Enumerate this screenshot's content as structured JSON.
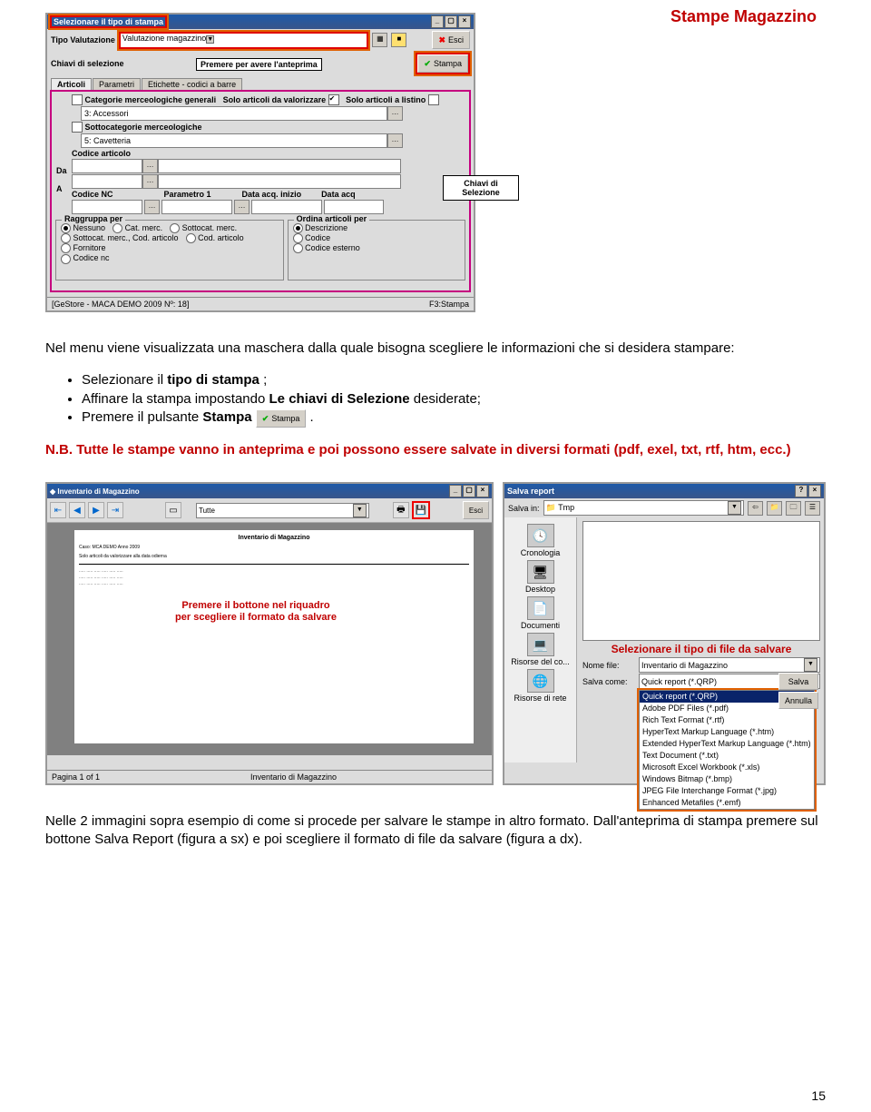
{
  "header": "Stampe Magazzino",
  "dlg1": {
    "title": "Selezionare il tipo di stampa",
    "tipo_label": "Tipo Valutazione",
    "tipo_combo": "Valutazione magazzino",
    "esci_btn": "Esci",
    "chiavi_label": "Chiavi di selezione",
    "premi_hint": "Premere per avere l'anteprima",
    "stampa_btn": "Stampa",
    "tabs": [
      "Articoli",
      "Parametri",
      "Etichette - codici a barre"
    ],
    "cat_label": "Categorie merceologiche generali",
    "solo_val": "Solo articoli da valorizzare",
    "solo_list": "Solo articoli a listino",
    "cat_value": "3: Accessori",
    "sottocat_label": "Sottocategorie merceologiche",
    "sottocat_value": "5: Cavetteria",
    "codart_label": "Codice articolo",
    "da": "Da",
    "a": "A",
    "codenc": "Codice NC",
    "param1": "Parametro 1",
    "dataacq": "Data acq. inizio",
    "dataacqf": "Data acq",
    "callout_chiavi": "Chiavi di Selezione",
    "grp_raggruppa": "Raggruppa per",
    "rg_opts": [
      "Nessuno",
      "Cat. merc.",
      "Sottocat. merc.",
      "Sottocat. merc., Cod. articolo",
      "Cod. articolo",
      "Fornitore",
      "Codice nc"
    ],
    "grp_ordina": "Ordina articoli per",
    "ord_opts": [
      "Descrizione",
      "Codice",
      "Codice esterno"
    ],
    "status_l": "[GeStore - MACA DEMO 2009 Nº: 18]",
    "status_r": "F3:Stampa"
  },
  "body": {
    "p1": "Nel menu viene visualizzata una maschera dalla quale bisogna scegliere le informazioni che si desidera stampare:",
    "li1_a": "Selezionare il ",
    "li1_b": "tipo di stampa",
    "li1_c": " ;",
    "li2_a": "Affinare la stampa impostando ",
    "li2_b": "Le chiavi di Selezione",
    "li2_c": " desiderate;",
    "li3_a": "Premere il pulsante ",
    "li3_b": "Stampa",
    "li3_c": " .",
    "nb": "N.B. Tutte le stampe vanno in anteprima e poi possono essere salvate in diversi formati (pdf, exel, txt, rtf, htm, ecc.)",
    "foot": "Nelle 2 immagini sopra esempio di come si procede per salvare le stampe in altro formato. Dall'anteprima di stampa premere sul bottone Salva Report (figura a sx) e poi scegliere il formato di file da salvare (figura a dx)."
  },
  "dlg2": {
    "title": "Inventario di Magazzino",
    "tutte": "Tutte",
    "esci": "Esci",
    "callout": "Premere il bottone nel riquadro per scegliere il formato da salvare",
    "pagina": "Pagina 1 of 1",
    "report_name": "Inventario di Magazzino",
    "sheet_title": "Inventario di Magazzino",
    "sheet_sub": "Caso: MCA DEMO Anno 2009",
    "sheet_sub2": "Solo articoli da valorizzare alla data odierna"
  },
  "dlg3": {
    "title": "Salva report",
    "salvain": "Salva in:",
    "folder": "Tmp",
    "side": [
      "Cronologia",
      "Desktop",
      "Documenti",
      "Risorse del co...",
      "Risorse di rete"
    ],
    "nomefile_lbl": "Nome file:",
    "nomefile_val": "Inventario di Magazzino",
    "salvacome_lbl": "Salva come:",
    "salvacome_val": "Quick report (*.QRP)",
    "formats": [
      "Quick report (*.QRP)",
      "Adobe PDF Files (*.pdf)",
      "Rich Text Format (*.rtf)",
      "HyperText Markup Language (*.htm)",
      "Extended HyperText Markup Language (*.htm)",
      "Text Document (*.txt)",
      "Microsoft Excel Workbook (*.xls)",
      "Windows Bitmap (*.bmp)",
      "JPEG File Interchange Format (*.jpg)",
      "Enhanced Metafiles (*.emf)"
    ],
    "salva_btn": "Salva",
    "annulla_btn": "Annulla",
    "callout": "Selezionare il tipo di file da salvare"
  },
  "page_num": "15"
}
